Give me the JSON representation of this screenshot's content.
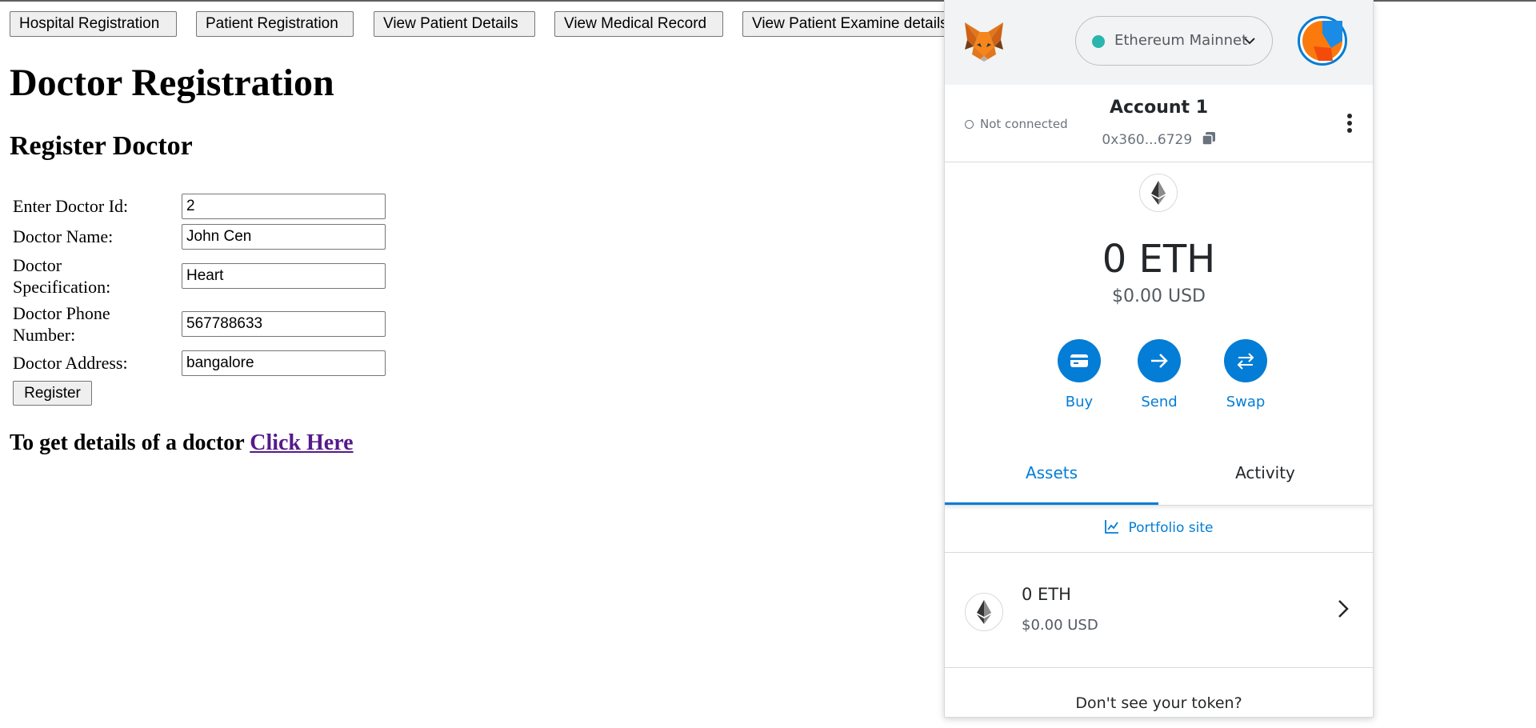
{
  "nav": {
    "buttons": [
      "Hospital Registration",
      "Patient Registration",
      "View Patient Details",
      "View Medical Record",
      "View Patient Examine details"
    ]
  },
  "page": {
    "title": "Doctor Registration",
    "subtitle": "Register Doctor",
    "form": {
      "id_label": "Enter Doctor Id:",
      "id_value": "2",
      "name_label": "Doctor Name:",
      "name_value": "John Cen",
      "spec_label_1": "Doctor",
      "spec_label_2": "Specification:",
      "spec_value": "Heart",
      "phone_label_1": "Doctor Phone",
      "phone_label_2": "Number:",
      "phone_value": "567788633",
      "address_label": "Doctor Address:",
      "address_value": "bangalore",
      "register_label": "Register"
    },
    "details_text": "To get details of a doctor",
    "details_link": "Click Here"
  },
  "metamask": {
    "network": "Ethereum Mainnet",
    "connection_status": "Not connected",
    "account_name": "Account 1",
    "address": "0x360...6729",
    "balance": "0 ETH",
    "balance_usd": "$0.00 USD",
    "actions": [
      "Buy",
      "Send",
      "Swap"
    ],
    "tabs": [
      "Assets",
      "Activity"
    ],
    "active_tab": "Assets",
    "portfolio_link": "Portfolio site",
    "assets": [
      {
        "name": "0 ETH",
        "usd": "$0.00 USD"
      }
    ],
    "dont_see_token": "Don't see your token?",
    "colors": {
      "accent": "#037dd6",
      "network_dot": "#29b6af",
      "header_bg": "#f2f3f4"
    }
  }
}
